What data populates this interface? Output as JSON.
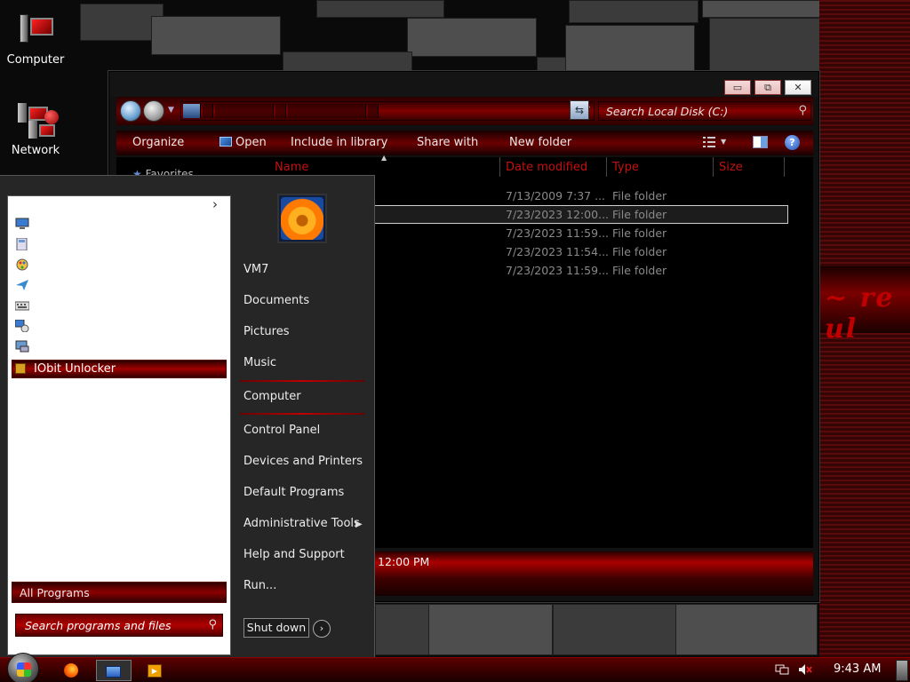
{
  "desktop": {
    "icons": [
      {
        "label": "Computer"
      },
      {
        "label": "Network"
      }
    ]
  },
  "explorer": {
    "search_placeholder": "Search Local Disk (C:)",
    "toolbar": {
      "organize": "Organize",
      "open": "Open",
      "include_in_library": "Include in library",
      "share_with": "Share with",
      "new_folder": "New folder"
    },
    "nav_favorites": "Favorites",
    "columns": {
      "name": "Name",
      "date_modified": "Date modified",
      "type": "Type",
      "size": "Size"
    },
    "rows": [
      {
        "date": "7/13/2009 7:37 ...",
        "type": "File folder",
        "selected": false
      },
      {
        "date": "7/23/2023 12:00...",
        "type": "File folder",
        "selected": true
      },
      {
        "date": "7/23/2023 11:59...",
        "type": "File folder",
        "selected": false
      },
      {
        "date": "7/23/2023 11:54...",
        "type": "File folder",
        "selected": false
      },
      {
        "date": "7/23/2023 11:59...",
        "type": "File folder",
        "selected": false
      }
    ],
    "details_text": "12:00 PM"
  },
  "start_menu": {
    "selected_program": "IObit Unlocker",
    "all_programs": "All Programs",
    "search_placeholder": "Search programs and files",
    "right_items": {
      "user": "VM7",
      "documents": "Documents",
      "pictures": "Pictures",
      "music": "Music",
      "computer": "Computer",
      "control_panel": "Control Panel",
      "devices_printers": "Devices and Printers",
      "default_programs": "Default Programs",
      "admin_tools": "Administrative Tools",
      "help_support": "Help and Support",
      "run": "Run..."
    },
    "shutdown": "Shut down"
  },
  "taskbar": {
    "clock": "9:43 AM"
  },
  "colors": {
    "accent_red": "#8a0000",
    "header_red": "#c41010"
  }
}
